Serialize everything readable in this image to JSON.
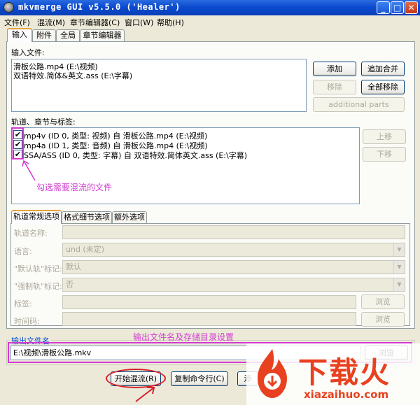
{
  "window": {
    "title": "mkvmerge GUI v5.5.0 ('Healer')"
  },
  "menu": [
    "文件(F)",
    "混流(M)",
    "章节编辑器(C)",
    "窗口(W)",
    "帮助(H)"
  ],
  "tabs": [
    "输入",
    "附件",
    "全局",
    "章节编辑器"
  ],
  "input_files": {
    "label": "输入文件:",
    "items": [
      "滑板公路.mp4 (E:\\视频)",
      "双语特效.简体&英文.ass (E:\\字幕)"
    ],
    "buttons": {
      "add": "添加",
      "append": "追加合并",
      "remove": "移除",
      "remove_all": "全部移除",
      "additional": "additional parts"
    }
  },
  "tracks": {
    "label": "轨道、章节与标签:",
    "items": [
      {
        "checked": true,
        "text": "mp4v (ID 0, 类型: 视频) 自 滑板公路.mp4 (E:\\视频)"
      },
      {
        "checked": true,
        "text": "mp4a (ID 1, 类型: 音频) 自 滑板公路.mp4 (E:\\视频)"
      },
      {
        "checked": true,
        "text": "SSA/ASS (ID 0, 类型: 字幕) 自 双语特效.简体英文.ass (E:\\字幕)"
      }
    ],
    "buttons": {
      "up": "上移",
      "down": "下移"
    }
  },
  "annotations": {
    "tracks_note": "勾选需要混流的文件",
    "output_note": "输出文件名及存储目录设置"
  },
  "subtabs": [
    "轨道常规选项",
    "格式细节选项",
    "额外选项"
  ],
  "track_options": {
    "track_name": "轨道名称:",
    "language": "语言:",
    "language_value": "und (未定)",
    "default_flag": "\"默认轨\"标记:",
    "default_value": "默认",
    "forced_flag": "\"强制轨\"标记:",
    "forced_value": "否",
    "tags": "标签:",
    "timecodes": "时间码:",
    "browse": "浏览"
  },
  "output": {
    "label": "输出文件名",
    "value": "E:\\视频\\滑板公路.mkv",
    "browse": "浏览"
  },
  "bottom_buttons": {
    "start": "开始混流(R)",
    "copy": "复制命令行(C)",
    "add_partial": "添"
  },
  "watermark": {
    "brand": "下载火",
    "url": "xiazaihuo.com"
  },
  "colors": {
    "annotation": "#d23bd2",
    "titlebar": "#0b4bd0",
    "tab_highlight": "#e6a33a",
    "watermark": "#e8411f"
  }
}
